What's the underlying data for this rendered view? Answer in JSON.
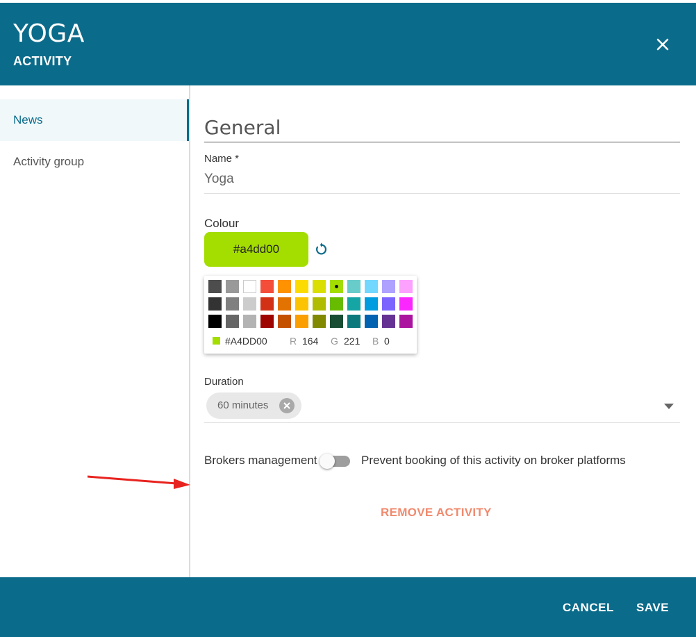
{
  "header": {
    "title": "YOGA",
    "subtitle": "ACTIVITY"
  },
  "sidebar": {
    "items": [
      {
        "label": "News",
        "active": true
      },
      {
        "label": "Activity group",
        "active": false
      }
    ]
  },
  "form": {
    "section_title": "General",
    "name": {
      "label": "Name *",
      "value": "Yoga"
    },
    "colour": {
      "label": "Colour",
      "value": "#a4dd00"
    },
    "palette": {
      "selected_hex": "#A4DD00",
      "r_label": "R",
      "r": "164",
      "g_label": "G",
      "g": "221",
      "b_label": "B",
      "b": "0",
      "rows": [
        [
          "#4d4d4d",
          "#999999",
          "#ffffff",
          "#f44e3b",
          "#fe9200",
          "#fcdc00",
          "#dbdf00",
          "#a4dd00",
          "#68ccca",
          "#73d8ff",
          "#aea1ff",
          "#fda1ff"
        ],
        [
          "#333333",
          "#808080",
          "#cccccc",
          "#d33115",
          "#e27300",
          "#fcc400",
          "#b0bc00",
          "#68bc00",
          "#16a5a5",
          "#009ce0",
          "#7b64ff",
          "#fa28ff"
        ],
        [
          "#000000",
          "#666666",
          "#b3b3b3",
          "#9f0500",
          "#c45100",
          "#fb9e00",
          "#808900",
          "#194d33",
          "#0c797d",
          "#0062b1",
          "#653294",
          "#ab149e"
        ]
      ]
    },
    "duration": {
      "label": "Duration",
      "chip": "60 minutes"
    },
    "brokers": {
      "label": "Brokers management",
      "toggle_on": false,
      "description": "Prevent booking of this activity on broker platforms"
    },
    "remove_label": "REMOVE ACTIVITY"
  },
  "footer": {
    "cancel_label": "CANCEL",
    "save_label": "SAVE"
  },
  "colors": {
    "brand": "#0b6b8a",
    "accent_remove": "#f08a6e",
    "annotation_arrow": "#e8231f"
  },
  "icons": {
    "close": "close-icon",
    "reset": "reset-icon",
    "chip_remove": "clear-chip-icon",
    "dropdown": "dropdown-arrow-icon"
  }
}
